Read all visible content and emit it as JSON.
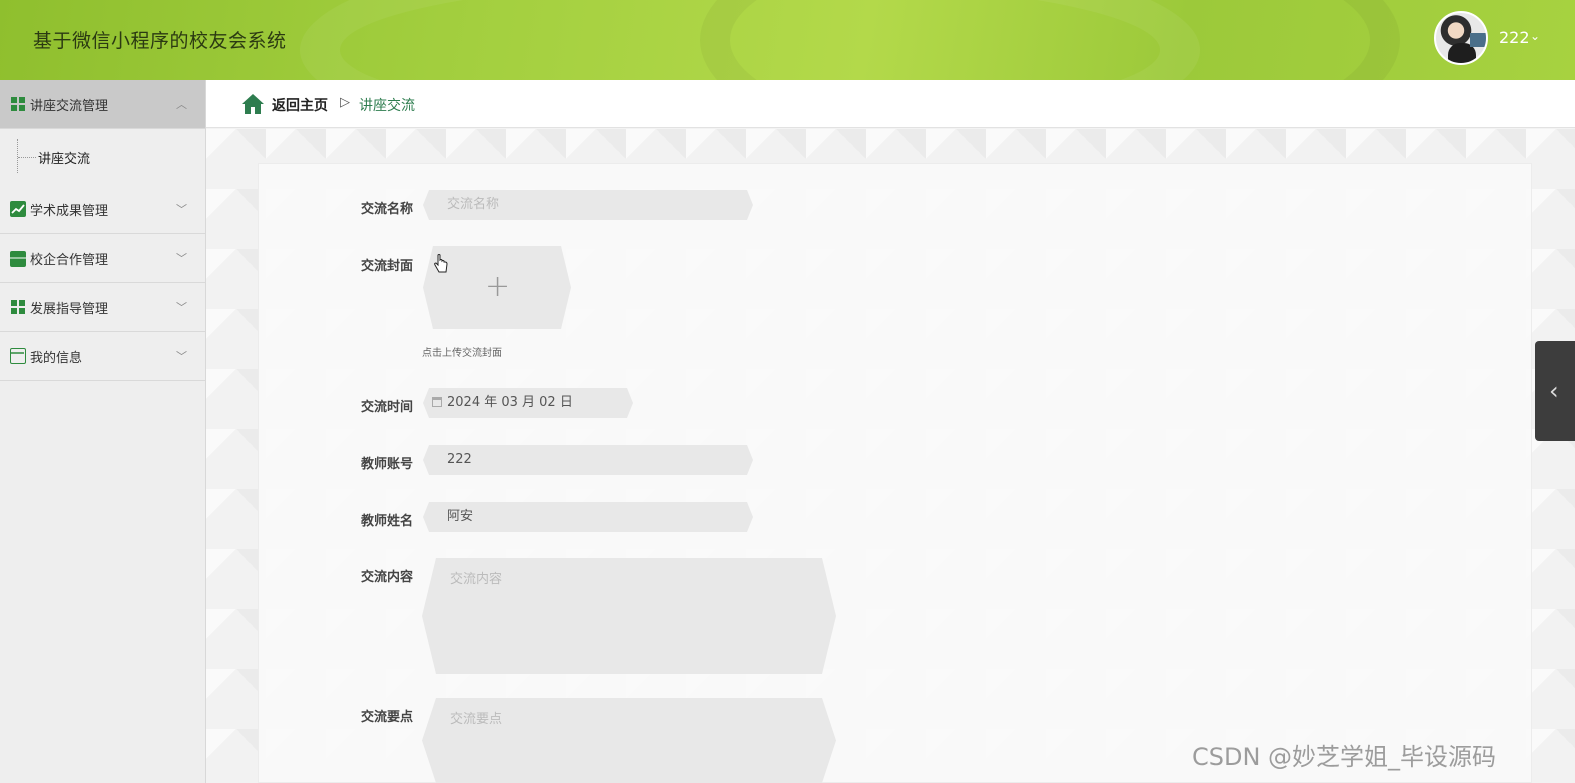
{
  "header": {
    "title": "基于微信小程序的校友会系统",
    "user_name": "222",
    "caret": "⌄"
  },
  "sidebar": {
    "items": [
      {
        "label": "讲座交流管理",
        "icon": "grid-icon",
        "expanded": true,
        "chevron": "︿"
      },
      {
        "label": "学术成果管理",
        "icon": "chart-icon",
        "chevron": "﹀"
      },
      {
        "label": "校企合作管理",
        "icon": "briefcase-icon",
        "chevron": "﹀"
      },
      {
        "label": "发展指导管理",
        "icon": "grid-icon",
        "chevron": "﹀"
      },
      {
        "label": "我的信息",
        "icon": "card-icon",
        "chevron": "﹀"
      }
    ],
    "sub_items": [
      {
        "label": "讲座交流"
      }
    ]
  },
  "breadcrumb": {
    "home": "返回主页",
    "separator": "▷",
    "current": "讲座交流"
  },
  "form": {
    "name_label": "交流名称",
    "name_placeholder": "交流名称",
    "cover_label": "交流封面",
    "cover_plus": "+",
    "cover_hint": "点击上传交流封面",
    "time_label": "交流时间",
    "time_value": "2024 年 03 月 02 日",
    "teacher_account_label": "教师账号",
    "teacher_account_value": "222",
    "teacher_name_label": "教师姓名",
    "teacher_name_value": "阿安",
    "content_label": "交流内容",
    "content_placeholder": "交流内容",
    "points_label": "交流要点",
    "points_placeholder": "交流要点"
  },
  "side_tab": {
    "icon": "‹"
  },
  "watermark": "CSDN @妙芝学姐_毕设源码",
  "colors": {
    "header_green": "#a3cf3f",
    "accent_green": "#2e8b3e",
    "field_bg": "#e8e8e8"
  }
}
